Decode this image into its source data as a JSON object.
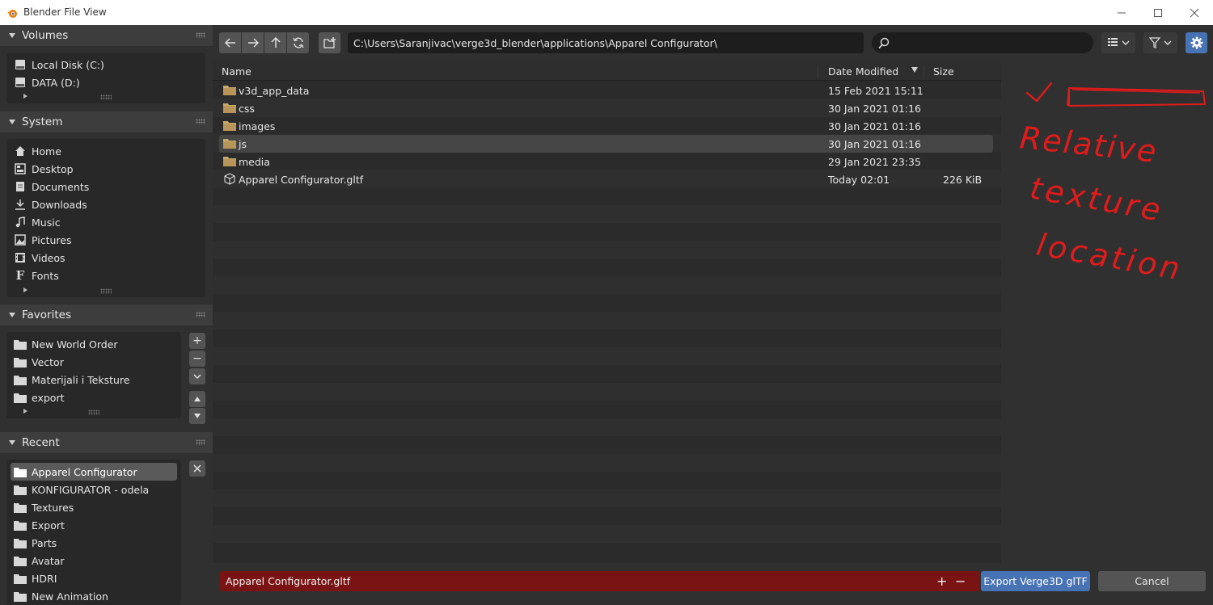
{
  "window": {
    "title": "Blender File View"
  },
  "volumes": {
    "header": "Volumes",
    "items": [
      {
        "label": "Local Disk (C:)",
        "icon": "disk-icon"
      },
      {
        "label": "DATA (D:)",
        "icon": "disk-icon"
      }
    ]
  },
  "system": {
    "header": "System",
    "items": [
      {
        "label": "Home",
        "icon": "home-icon"
      },
      {
        "label": "Desktop",
        "icon": "desktop-icon"
      },
      {
        "label": "Documents",
        "icon": "documents-icon"
      },
      {
        "label": "Downloads",
        "icon": "downloads-icon"
      },
      {
        "label": "Music",
        "icon": "music-icon"
      },
      {
        "label": "Pictures",
        "icon": "pictures-icon"
      },
      {
        "label": "Videos",
        "icon": "videos-icon"
      },
      {
        "label": "Fonts",
        "icon": "fonts-icon"
      }
    ]
  },
  "favorites": {
    "header": "Favorites",
    "items": [
      {
        "label": "New World Order"
      },
      {
        "label": "Vector"
      },
      {
        "label": "Materijali i Teksture"
      },
      {
        "label": "export"
      }
    ]
  },
  "recent": {
    "header": "Recent",
    "items": [
      {
        "label": "Apparel Configurator",
        "selected": true
      },
      {
        "label": "KONFIGURATOR - odela"
      },
      {
        "label": "Textures"
      },
      {
        "label": "Export"
      },
      {
        "label": "Parts"
      },
      {
        "label": "Avatar"
      },
      {
        "label": "HDRI"
      },
      {
        "label": "New Animation"
      }
    ]
  },
  "toolbar": {
    "path": "C:\\Users\\Saranjivac\\verge3d_blender\\applications\\Apparel Configurator\\",
    "search_placeholder": ""
  },
  "columns": {
    "name": "Name",
    "date": "Date Modified",
    "size": "Size"
  },
  "files": [
    {
      "name": "v3d_app_data",
      "date": "15 Feb 2021 15:11",
      "size": "",
      "type": "folder"
    },
    {
      "name": "css",
      "date": "30 Jan 2021 01:16",
      "size": "",
      "type": "folder"
    },
    {
      "name": "images",
      "date": "30 Jan 2021 01:16",
      "size": "",
      "type": "folder"
    },
    {
      "name": "js",
      "date": "30 Jan 2021 01:16",
      "size": "",
      "type": "folder",
      "highlighted": true
    },
    {
      "name": "media",
      "date": "29 Jan 2021 23:35",
      "size": "",
      "type": "folder"
    },
    {
      "name": "Apparel Configurator.gltf",
      "date": "Today 02:01",
      "size": "226 KiB",
      "type": "file"
    }
  ],
  "bottom": {
    "filename": "Apparel Configurator.gltf",
    "export_label": "Export Verge3D glTF",
    "cancel_label": "Cancel"
  },
  "annotation": {
    "lines": [
      "Relative",
      "texture",
      "location"
    ],
    "color": "#e01b1b"
  },
  "colors": {
    "accent": "#4772b3",
    "filename_bg": "#7a1414",
    "folder": "#c8a86b"
  }
}
